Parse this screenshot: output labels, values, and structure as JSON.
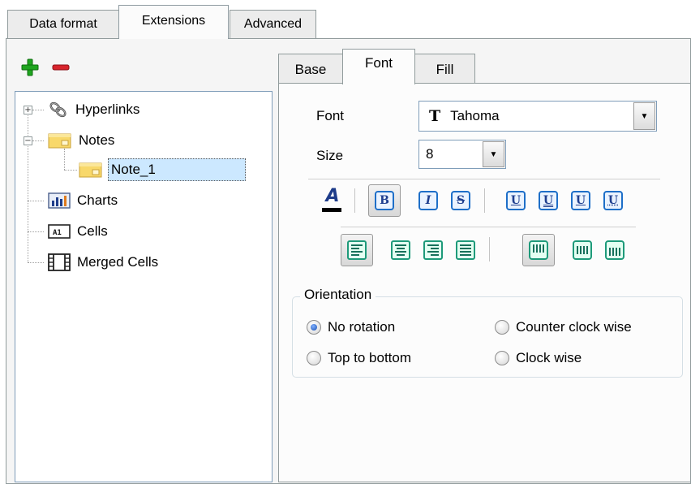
{
  "top_tabs": [
    {
      "label": "Data format",
      "active": false
    },
    {
      "label": "Extensions",
      "active": true
    },
    {
      "label": "Advanced",
      "active": false
    }
  ],
  "left_toolbar": {
    "add_icon": "plus-icon",
    "remove_icon": "minus-icon",
    "add_color": "#1fa51f",
    "remove_color": "#d8242c"
  },
  "tree": {
    "items": [
      {
        "label": "Hyperlinks",
        "icon": "hyperlink-icon",
        "expander": "+"
      },
      {
        "label": "Notes",
        "icon": "note-icon",
        "expander": "−"
      },
      {
        "label": "Note_1",
        "icon": "note-icon",
        "selected": true
      },
      {
        "label": "Charts",
        "icon": "chart-icon"
      },
      {
        "label": "Cells",
        "icon": "cells-icon"
      },
      {
        "label": "Merged Cells",
        "icon": "merged-cells-icon"
      }
    ]
  },
  "sub_tabs": [
    {
      "label": "Base",
      "active": false
    },
    {
      "label": "Font",
      "active": true
    },
    {
      "label": "Fill",
      "active": false
    }
  ],
  "font_panel": {
    "font_label": "Font",
    "font_value": "Tahoma",
    "font_type_glyph": "T",
    "size_label": "Size",
    "size_value": "8",
    "bold_glyph": "B",
    "italic_glyph": "I",
    "strike_glyph": "S",
    "underline_glyph": "U",
    "font_color_glyph": "A"
  },
  "orientation": {
    "title": "Orientation",
    "options": [
      {
        "label": "No rotation",
        "checked": true
      },
      {
        "label": "Counter clock wise",
        "checked": false
      },
      {
        "label": "Top to bottom",
        "checked": false
      },
      {
        "label": "Clock wise",
        "checked": false
      }
    ]
  },
  "colors": {
    "selection": "#cce8ff",
    "accent_blue": "#1e6fc8",
    "accent_green": "#1e9a7a"
  }
}
